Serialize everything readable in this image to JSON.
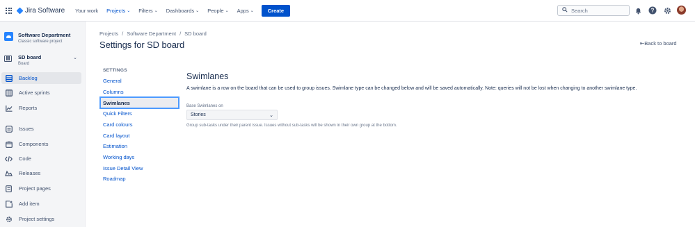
{
  "topnav": {
    "product": "Jira Software",
    "items": [
      {
        "label": "Your work",
        "dropdown": false
      },
      {
        "label": "Projects",
        "dropdown": true,
        "active": true
      },
      {
        "label": "Filters",
        "dropdown": true
      },
      {
        "label": "Dashboards",
        "dropdown": true
      },
      {
        "label": "People",
        "dropdown": true
      },
      {
        "label": "Apps",
        "dropdown": true
      }
    ],
    "create_label": "Create",
    "search_placeholder": "Search",
    "icons": [
      "notifications-icon",
      "help-icon",
      "settings-icon",
      "avatar"
    ]
  },
  "sidebar": {
    "project_name": "Software Department",
    "project_type": "Classic software project",
    "board_name": "SD board",
    "board_type": "Board",
    "items": [
      {
        "label": "Backlog",
        "icon": "backlog-icon",
        "active": true
      },
      {
        "label": "Active sprints",
        "icon": "active-sprints-icon"
      },
      {
        "label": "Reports",
        "icon": "reports-icon"
      },
      {
        "label": "Issues",
        "icon": "issues-icon"
      },
      {
        "label": "Components",
        "icon": "components-icon"
      },
      {
        "label": "Code",
        "icon": "code-icon"
      },
      {
        "label": "Releases",
        "icon": "releases-icon"
      },
      {
        "label": "Project pages",
        "icon": "project-pages-icon"
      },
      {
        "label": "Add item",
        "icon": "add-item-icon"
      },
      {
        "label": "Project settings",
        "icon": "project-settings-icon"
      }
    ]
  },
  "breadcrumb": [
    "Projects",
    "Software Department",
    "SD board"
  ],
  "page_title": "Settings for SD board",
  "back_link": "Back to board",
  "settings_nav": {
    "heading": "SETTINGS",
    "items": [
      {
        "label": "General"
      },
      {
        "label": "Columns"
      },
      {
        "label": "Swimlanes",
        "active": true
      },
      {
        "label": "Quick Filters"
      },
      {
        "label": "Card colours"
      },
      {
        "label": "Card layout"
      },
      {
        "label": "Estimation"
      },
      {
        "label": "Working days"
      },
      {
        "label": "Issue Detail View"
      },
      {
        "label": "Roadmap"
      }
    ]
  },
  "swimlanes": {
    "title": "Swimlanes",
    "description": "A swimlane is a row on the board that can be used to group issues. Swimlane type can be changed below and will be saved automatically. Note: queries will not be lost when changing to another swimlane type.",
    "base_label": "Base Swimlanes on",
    "selected_value": "Stories",
    "help_text": "Group sub-tasks under their parent issue. Issues without sub-tasks will be shown in their own group at the bottom."
  },
  "colors": {
    "accent": "#0052cc",
    "focus_ring": "#4c9aff",
    "sidebar_bg": "#f4f5f7"
  }
}
